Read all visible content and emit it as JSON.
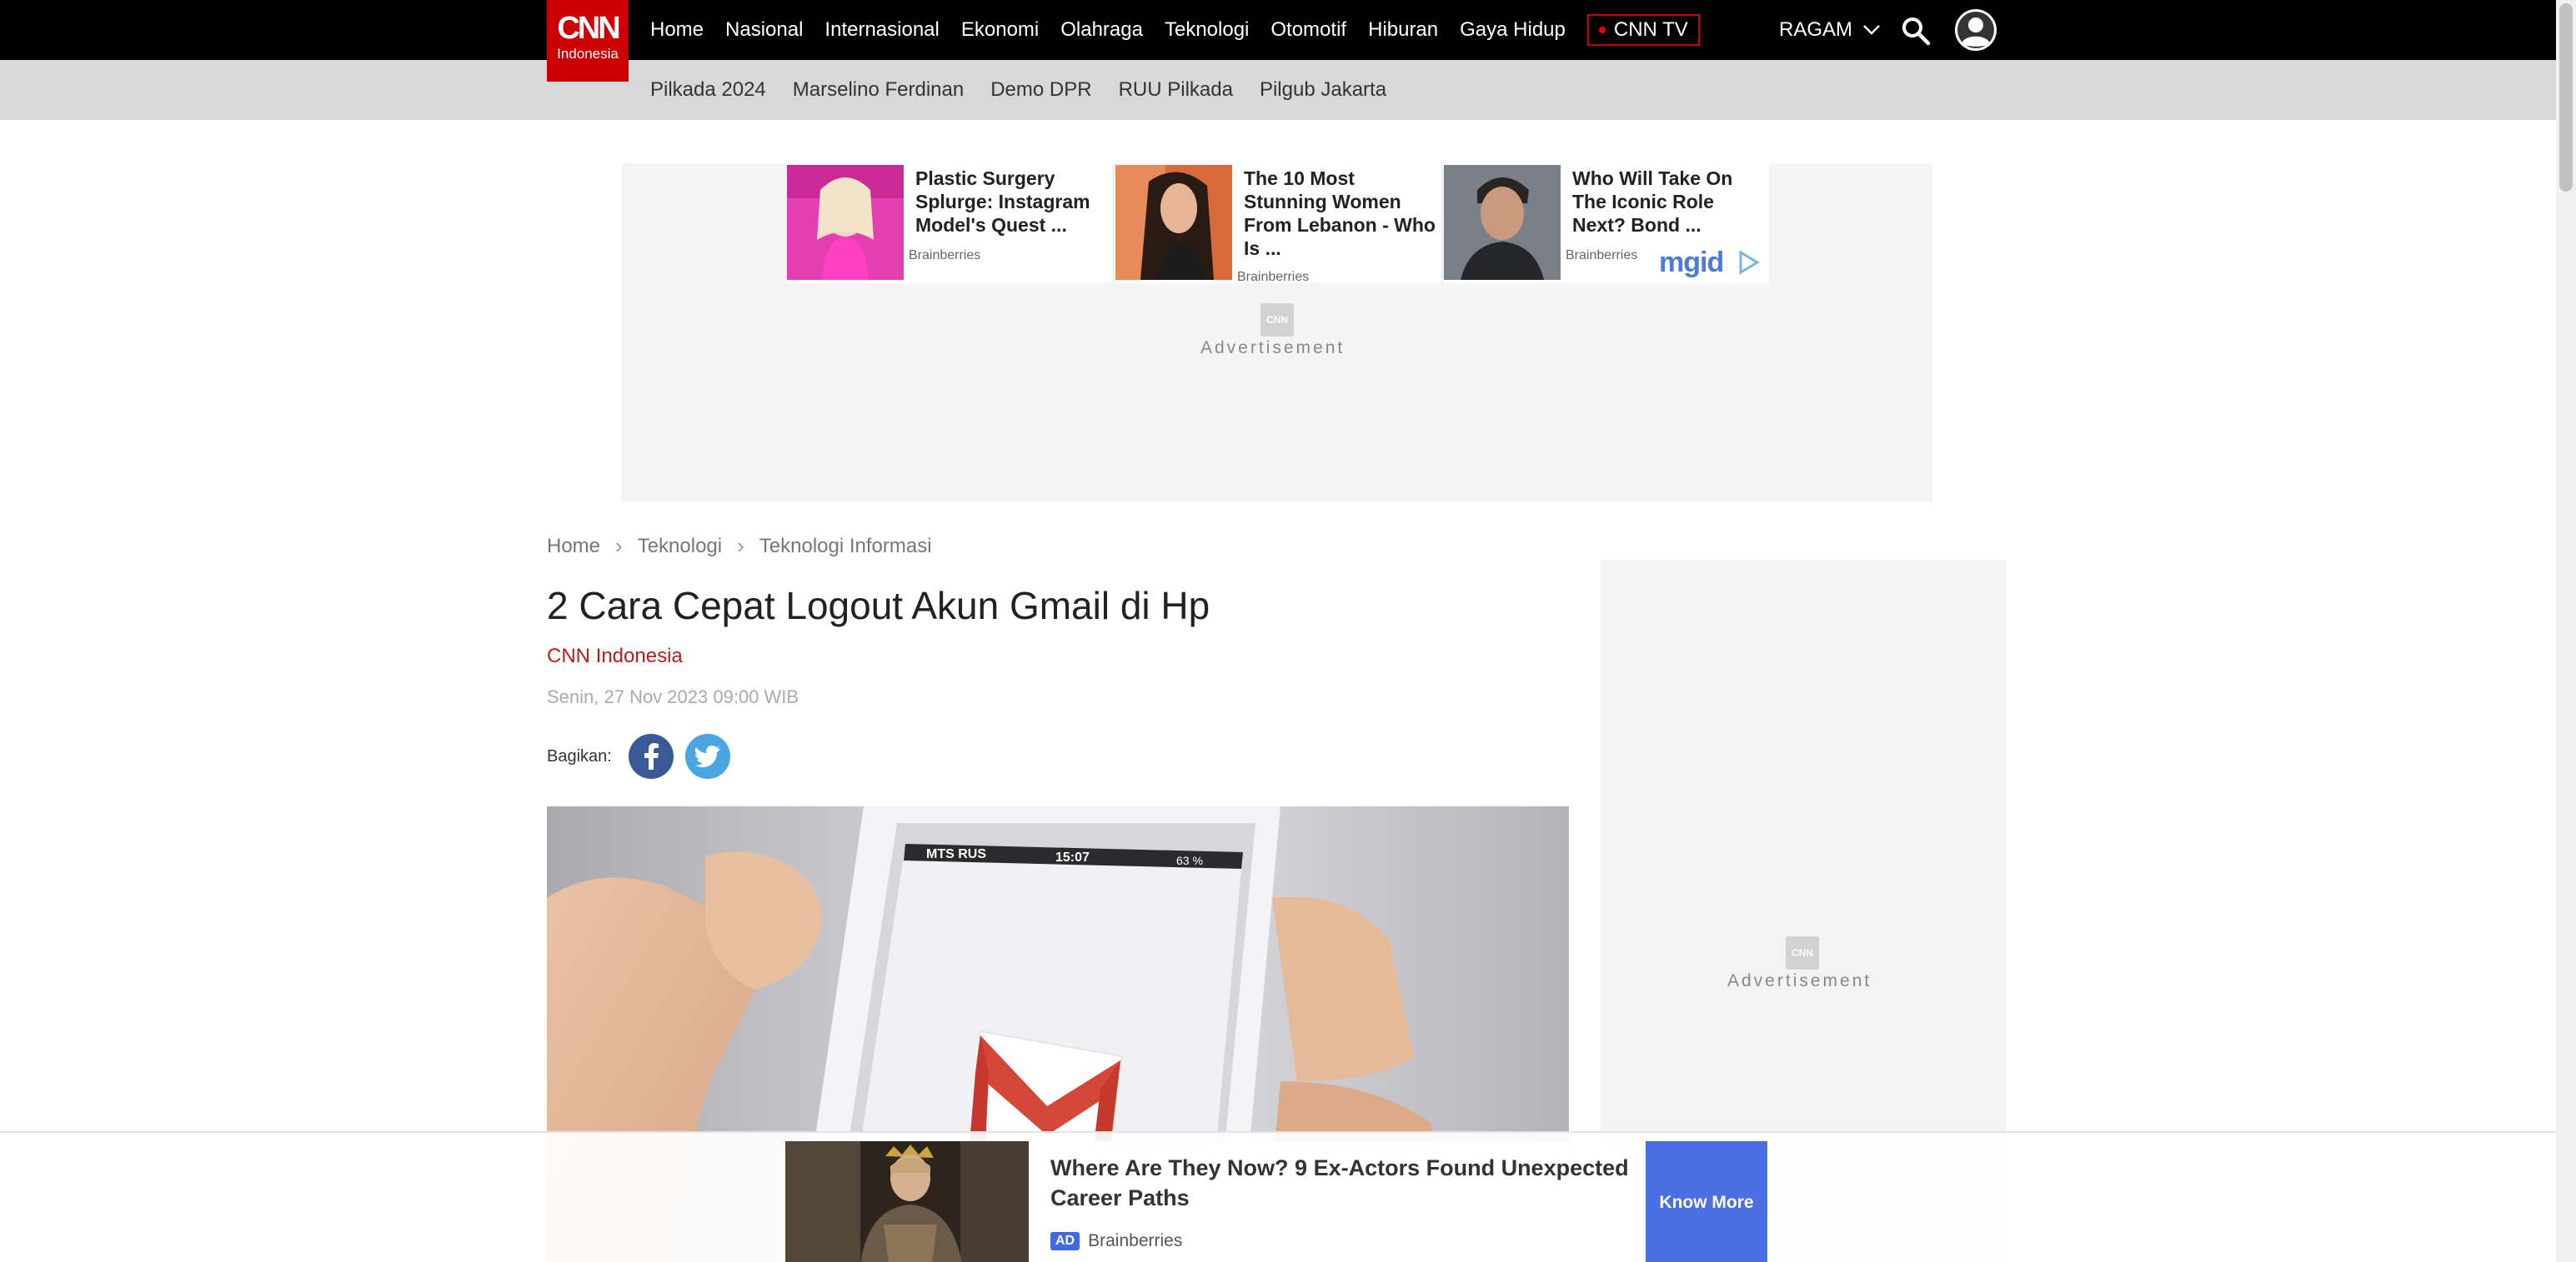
{
  "header": {
    "logo": {
      "line1": "CNN",
      "line2": "Indonesia"
    },
    "nav": [
      "Home",
      "Nasional",
      "Internasional",
      "Ekonomi",
      "Olahraga",
      "Teknologi",
      "Otomotif",
      "Hiburan",
      "Gaya Hidup"
    ],
    "cnn_tv": "CNN TV",
    "ragam": "RAGAM",
    "subnav": [
      "Pilkada 2024",
      "Marselino Ferdinan",
      "Demo DPR",
      "RUU Pilkada",
      "Pilgub Jakarta"
    ]
  },
  "top_ad": {
    "cards": [
      {
        "title": "Plastic Surgery Splurge: Instagram Model's Quest ...",
        "source": "Brainberries"
      },
      {
        "title": "The 10 Most Stunning Women From Lebanon - Who Is ...",
        "source": "Brainberries"
      },
      {
        "title": "Who Will Take On The Iconic Role Next? Bond ...",
        "source": "Brainberries"
      }
    ],
    "provider": "mgid",
    "ad_logo": "CNN",
    "label": "Advertisement"
  },
  "breadcrumb": [
    "Home",
    "Teknologi",
    "Teknologi Informasi"
  ],
  "article": {
    "title": "2 Cara Cepat Logout Akun Gmail di Hp",
    "author": "CNN Indonesia",
    "date": "Senin, 27 Nov 2023 09:00 WIB",
    "share_label": "Bagikan:",
    "phone_carrier": "MTS RUS",
    "phone_time": "15:07",
    "phone_battery": "63 %"
  },
  "sidebar_ad": {
    "ad_logo": "CNN",
    "label": "Advertisement"
  },
  "bottom_ad": {
    "title": "Where Are They Now? 9 Ex-Actors Found Unexpected Career Paths",
    "badge": "AD",
    "source": "Brainberries",
    "cta": "Know More"
  },
  "colors": {
    "brand_red": "#cc0000",
    "facebook": "#3b5998",
    "twitter": "#4aa6e3",
    "cta_blue": "#4a6fe3"
  }
}
